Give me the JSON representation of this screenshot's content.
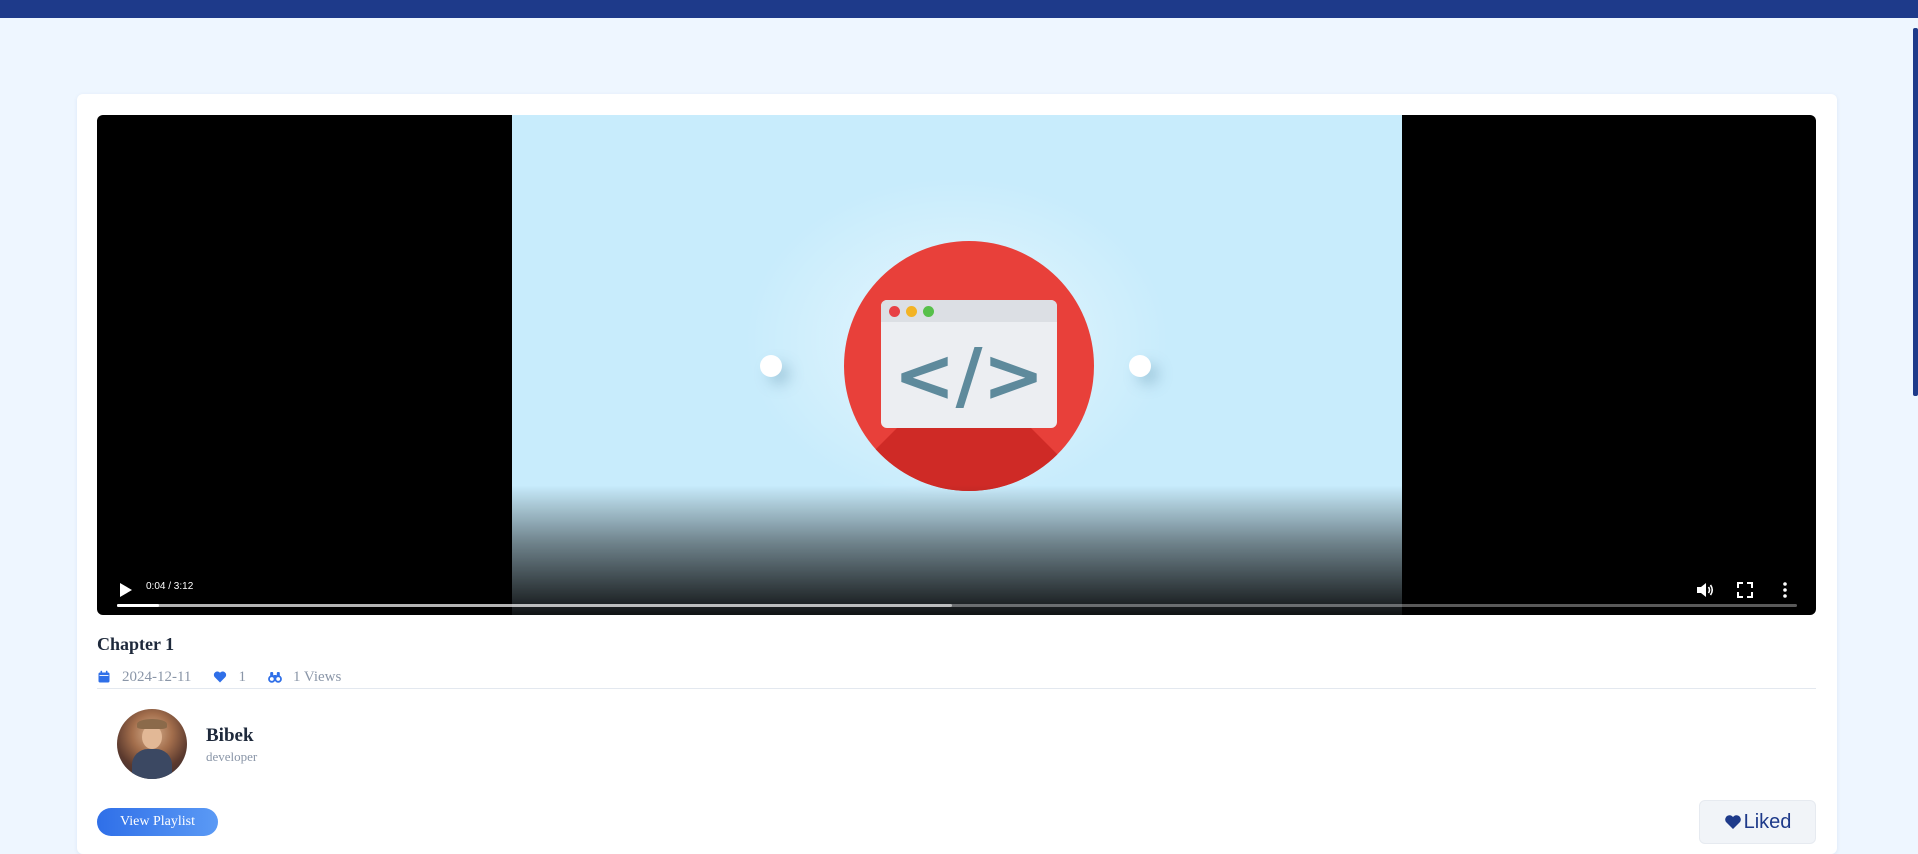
{
  "colors": {
    "header": "#1e3a8a",
    "page_background": "#eef6ff",
    "accent": "#2f6fe8",
    "text_primary": "#1e293b",
    "text_muted": "#8a96a8"
  },
  "video": {
    "current_time": "0:04",
    "duration": "3:12",
    "time_display": "0:04 / 3:12",
    "played_fraction": 0.025,
    "buffered_fraction": 0.497,
    "thumbnail_glyph": "</>",
    "controls": {
      "play_icon": "play-icon",
      "volume_icon": "volume-icon",
      "fullscreen_icon": "fullscreen-icon",
      "more_icon": "more-options-icon"
    }
  },
  "chapter": {
    "title": "Chapter 1",
    "date": "2024-12-11",
    "likes": "1",
    "views": "1 Views",
    "icons": {
      "date": "calendar-icon",
      "likes": "heart-icon",
      "views": "binoculars-icon"
    }
  },
  "author": {
    "name": "Bibek",
    "role": "developer"
  },
  "actions": {
    "view_playlist_label": "View Playlist",
    "liked_label": "Liked"
  }
}
